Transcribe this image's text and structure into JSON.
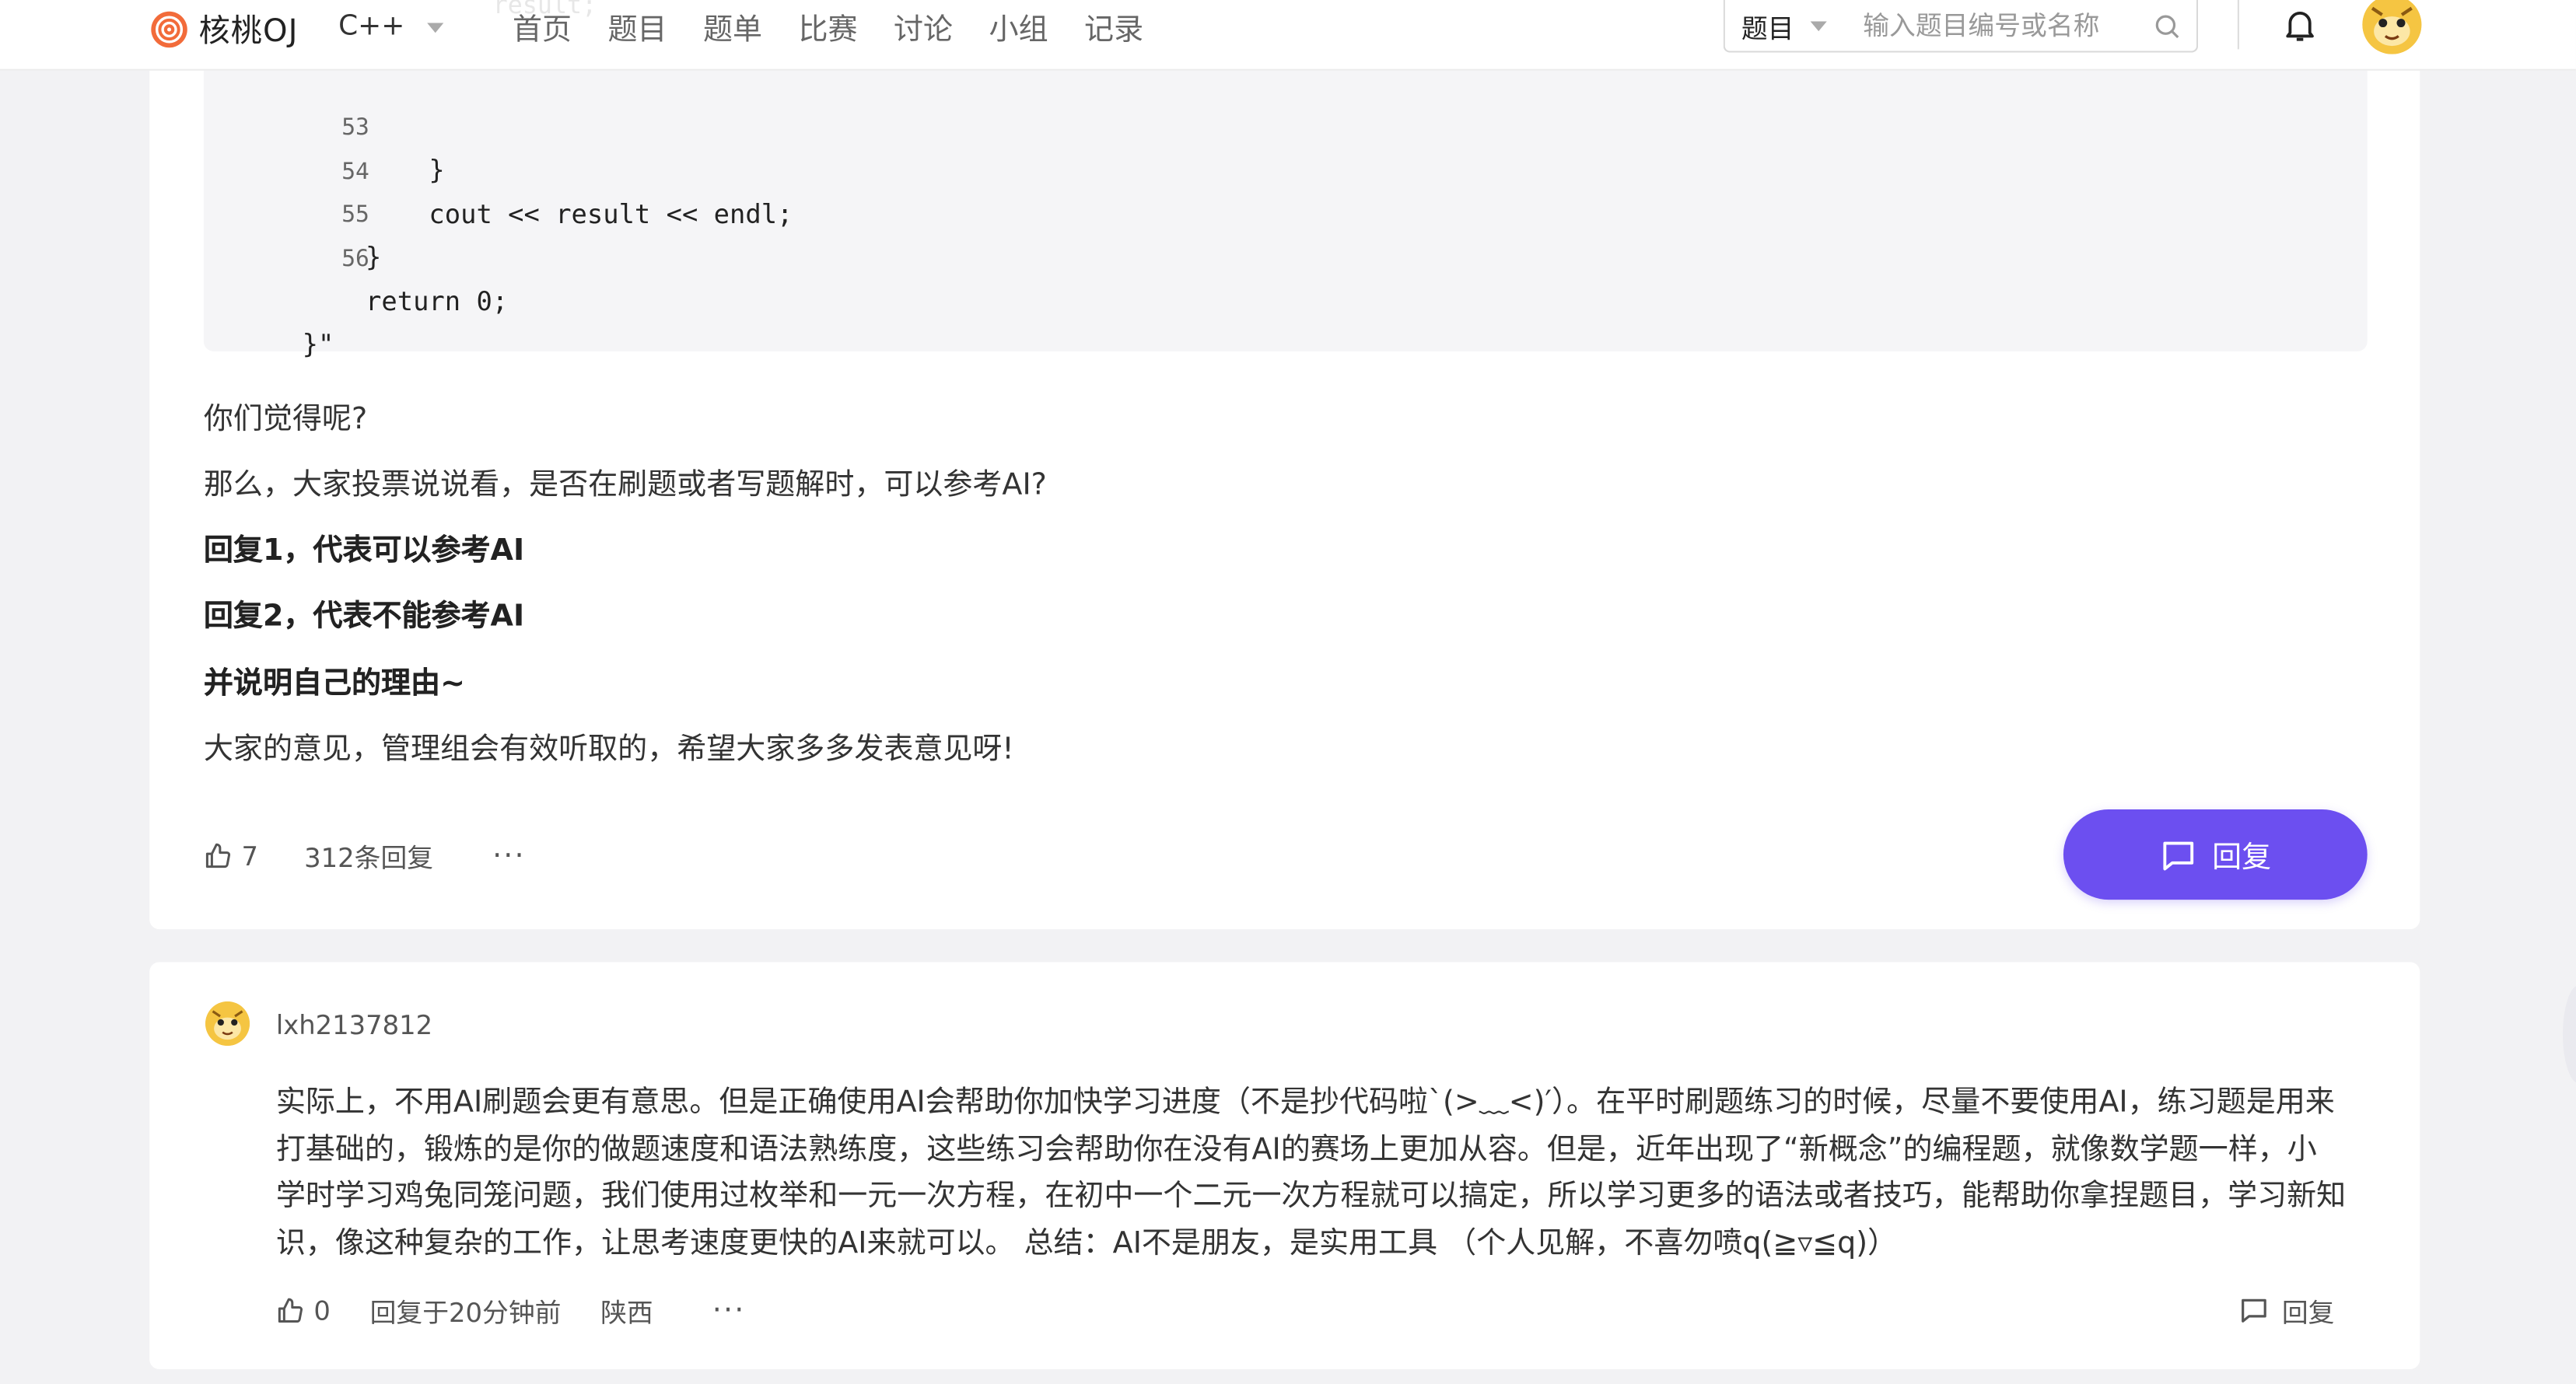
{
  "header": {
    "logo_text": "核桃OJ",
    "language": "C++",
    "nav": [
      "首页",
      "题目",
      "题单",
      "比赛",
      "讨论",
      "小组",
      "记录"
    ],
    "search": {
      "type": "题目",
      "placeholder": "输入题目编号或名称"
    },
    "ghost_code": "result;"
  },
  "post": {
    "code_lines": [
      {
        "num": "53",
        "text": "        }"
      },
      {
        "num": "54",
        "text": "        cout << result << endl;"
      },
      {
        "num": "55",
        "text": "    }"
      },
      {
        "num": "56",
        "text": "    return 0;"
      },
      {
        "num": "",
        "text": "}\""
      }
    ],
    "paragraphs": [
      {
        "text": "你们觉得呢?",
        "bold": false
      },
      {
        "text": "那么，大家投票说说看，是否在刷题或者写题解时，可以参考AI?",
        "bold": false
      },
      {
        "text": "回复1，代表可以参考AI",
        "bold": true
      },
      {
        "text": "回复2，代表不能参考AI",
        "bold": true
      },
      {
        "text": "并说明自己的理由~",
        "bold": true
      },
      {
        "text": "大家的意见，管理组会有效听取的，希望大家多多发表意见呀!",
        "bold": false
      }
    ],
    "likes": "7",
    "reply_count": "312条回复",
    "more": "···",
    "reply_button": "回复"
  },
  "reply": {
    "username": "lxh2137812",
    "body": "实际上，不用AI刷题会更有意思。但是正确使用AI会帮助你加快学习进度（不是抄代码啦`(>﹏<)′）。在平时刷题练习的时候，尽量不要使用AI，练习题是用来打基础的，锻炼的是你的做题速度和语法熟练度，这些练习会帮助你在没有AI的赛场上更加从容。但是，近年出现了“新概念”的编程题，就像数学题一样，小学时学习鸡兔同笼问题，我们使用过枚举和一元一次方程，在初中一个二元一次方程就可以搞定，所以学习更多的语法或者技巧，能帮助你拿捏题目，学习新知识，像这种复杂的工作，让思考速度更快的AI来就可以。 总结：AI不是朋友，是实用工具 （个人见解，不喜勿喷q(≧▿≦q)）",
    "likes": "0",
    "time": "回复于20分钟前",
    "location": "陕西",
    "more": "···",
    "reply_label": "回复"
  }
}
